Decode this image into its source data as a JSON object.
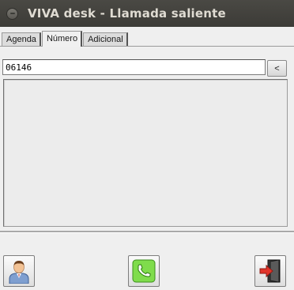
{
  "window": {
    "title": "VIVA desk - Llamada saliente"
  },
  "tabs": [
    {
      "label": "Agenda",
      "active": false
    },
    {
      "label": "Número",
      "active": true
    },
    {
      "label": "Adicional",
      "active": false
    }
  ],
  "numero": {
    "value": "06146",
    "back_label": "<"
  },
  "bottom_bar": {
    "contacts_icon": "user-icon",
    "call_icon": "phone-icon",
    "exit_icon": "exit-door-icon"
  },
  "colors": {
    "titlebar": "#3c3b37",
    "call_green": "#5fcf2f",
    "exit_red": "#d9342b"
  }
}
